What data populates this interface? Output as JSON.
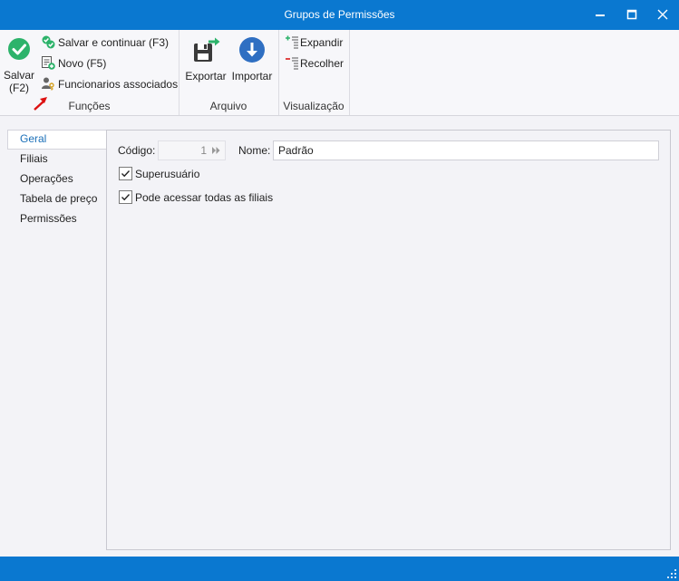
{
  "window": {
    "title": "Grupos de Permissões"
  },
  "ribbon": {
    "save": {
      "label": "Salvar",
      "shortcut": "(F2)"
    },
    "save_continue": "Salvar e continuar (F3)",
    "new": "Novo (F5)",
    "employees": "Funcionarios associados",
    "group_functions": "Funções",
    "export": "Exportar",
    "import": "Importar",
    "group_file": "Arquivo",
    "expand": "Expandir",
    "collapse": "Recolher",
    "group_view": "Visualização"
  },
  "nav": {
    "items": [
      {
        "label": "Geral",
        "selected": true
      },
      {
        "label": "Filiais"
      },
      {
        "label": "Operações"
      },
      {
        "label": "Tabela de preço"
      },
      {
        "label": "Permissões"
      }
    ]
  },
  "form": {
    "code_label": "Código:",
    "code_value": "1",
    "name_label": "Nome:",
    "name_value": "Padrão",
    "superuser_label": "Superusuário",
    "superuser_checked": true,
    "all_branches_label": "Pode acessar todas as filiais",
    "all_branches_checked": true
  },
  "colors": {
    "accent": "#0a78d0",
    "save_green": "#2db36b",
    "import_blue": "#2f6fc2",
    "export_dark": "#3a3a3a"
  }
}
